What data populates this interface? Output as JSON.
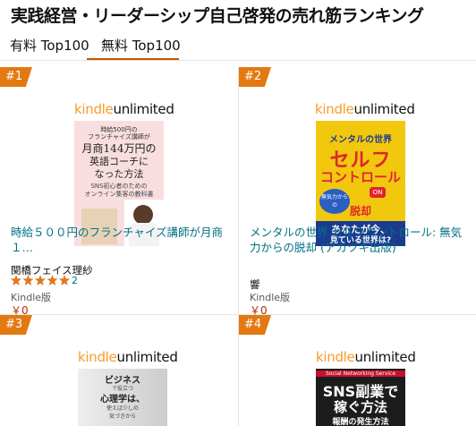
{
  "page": {
    "title": "実践経営・リーダーシップ自己啓発の売れ筋ランキング"
  },
  "tabs": [
    {
      "label": "有料 Top100"
    },
    {
      "label": "無料 Top100"
    }
  ],
  "colors": {
    "accent": "#e47911",
    "link": "#007185",
    "price": "#b12704",
    "tab_underline": "#c45500"
  },
  "products": [
    {
      "rank": "#1",
      "badge_k": "kindle",
      "badge_u": "unlimited",
      "cover": {
        "line1": "時給500円の",
        "line2": "フランチャイズ講師が",
        "line3": "月商144万円の",
        "line4": "英語コーチに",
        "line5": "なった方法",
        "line6": "SNS初心者のための",
        "line7": "オンライン集客の教科書",
        "line8": "関橋フェイス理紗",
        "line9": "「知識も人脈もない」お客様も自分も幸せにするビジネスの秘訣"
      },
      "title": "時給５００円のフランチャイズ講師が月商１…",
      "author": "関橋フェイス理紗",
      "rating_stars": 5,
      "rating_count": "2",
      "format": "Kindle版",
      "price": "￥0"
    },
    {
      "rank": "#2",
      "badge_k": "kindle",
      "badge_u": "unlimited",
      "cover": {
        "line1": "メンタルの世界",
        "line2": "セルフ",
        "line3": "コントロール",
        "line4": "無気力からの",
        "line5": "脱却",
        "line6": "ON",
        "line7": "あなたが今、",
        "line8": "見ている世界は?"
      },
      "title": "メンタルの世界 セルフコントロール: 無気力からの脱却 (アカツキ出版)",
      "author": "響",
      "format": "Kindle版",
      "price": "￥0"
    },
    {
      "rank": "#3",
      "badge_k": "kindle",
      "badge_u": "unlimited",
      "cover": {
        "line1": "ビジネス",
        "line2": "で役立つ",
        "line3": "心理学",
        "line4": "は、",
        "line5": "使えば少しの",
        "line6": "気づきから"
      }
    },
    {
      "rank": "#4",
      "badge_k": "kindle",
      "badge_u": "unlimited",
      "cover": {
        "line1": "Social Networking Service",
        "line2": "SNS副業で",
        "line3": "稼ぐ方法",
        "line4": "報酬の発生方法"
      }
    }
  ]
}
